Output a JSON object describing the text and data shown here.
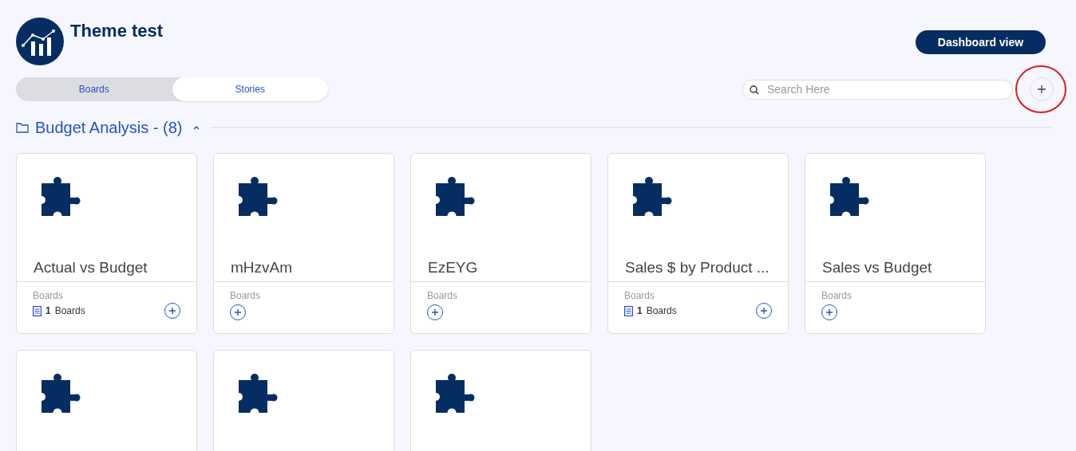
{
  "header": {
    "title": "Theme test",
    "dashboard_button": "Dashboard view"
  },
  "tabs": [
    {
      "label": "Boards",
      "selected": false
    },
    {
      "label": "Stories",
      "selected": true
    }
  ],
  "search": {
    "placeholder": "Search Here"
  },
  "section": {
    "title": "Budget Analysis - (8)",
    "expanded": true
  },
  "cards": [
    {
      "kind": "board",
      "title": "Actual vs Budget",
      "label": "Boards",
      "count": "1",
      "count_label": "Boards"
    },
    {
      "kind": "board",
      "title": "mHzvAm",
      "label": "Boards"
    },
    {
      "kind": "board",
      "title": "EzEYG",
      "label": "Boards"
    },
    {
      "kind": "board",
      "title": "Sales $ by Product ...",
      "label": "Boards",
      "count": "1",
      "count_label": "Boards"
    },
    {
      "kind": "board",
      "title": "Sales vs Budget",
      "label": "Boards"
    },
    {
      "kind": "cut"
    },
    {
      "kind": "cut"
    },
    {
      "kind": "cut"
    }
  ]
}
